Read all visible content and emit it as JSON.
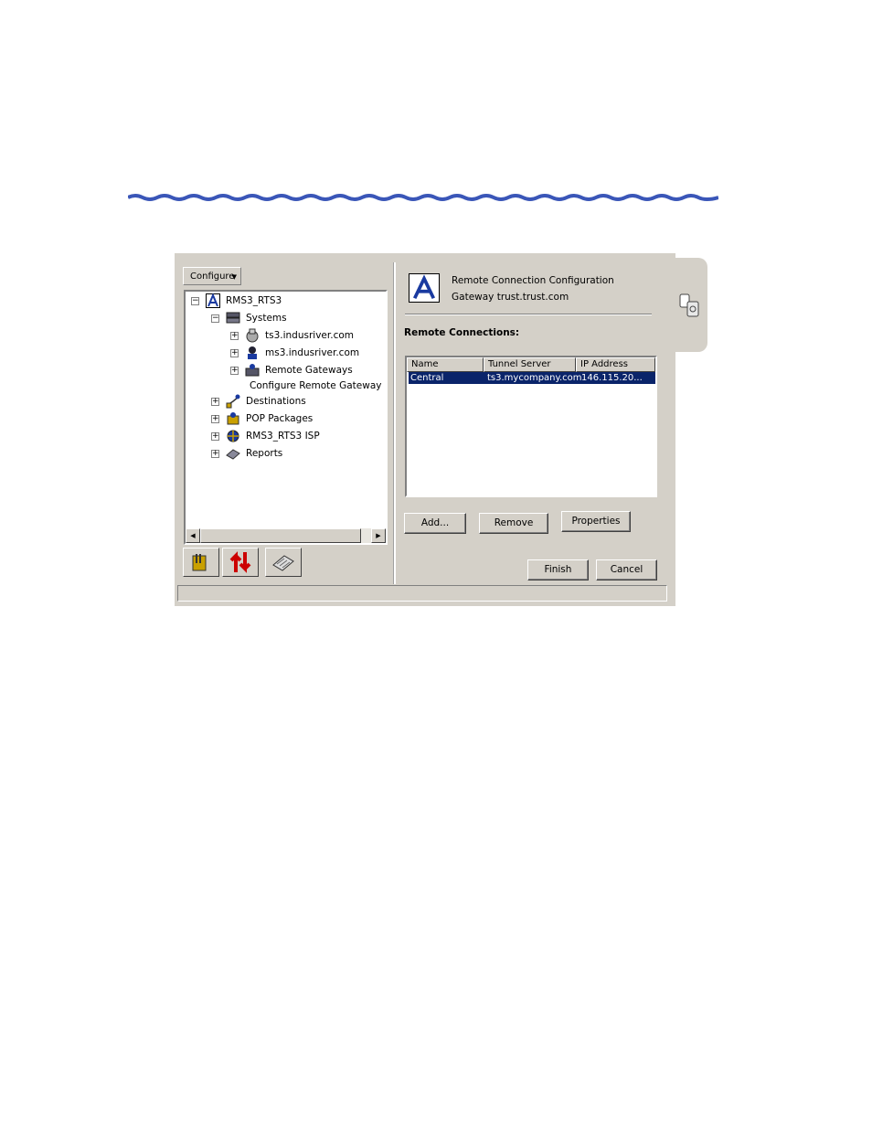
{
  "window": {
    "menu_button": "Configure",
    "colors": {
      "face": "#d4d0c8",
      "selection": "#0a246a",
      "wave": "#3a56b8"
    }
  },
  "tree": {
    "root": "RMS3_RTS3",
    "items": [
      {
        "label": "Systems",
        "icon": "systems-icon"
      },
      {
        "label": "ts3.indusriver.com",
        "icon": "server-icon"
      },
      {
        "label": "ms3.indusriver.com",
        "icon": "server-user-icon"
      },
      {
        "label": "Remote Gateways",
        "icon": "gateway-icon"
      },
      {
        "label": "Configure Remote Gateway",
        "icon": ""
      },
      {
        "label": "Destinations",
        "icon": "destinations-icon"
      },
      {
        "label": "POP Packages",
        "icon": "package-icon"
      },
      {
        "label": "RMS3_RTS3 ISP",
        "icon": "isp-icon"
      },
      {
        "label": "Reports",
        "icon": "reports-icon"
      }
    ]
  },
  "header": {
    "title_line1": "Remote Connection Configuration",
    "title_line2": "Gateway trust.trust.com"
  },
  "section_label": "Remote Connections:",
  "table": {
    "columns": [
      "Name",
      "Tunnel Server",
      "IP Address"
    ],
    "rows": [
      {
        "name": "Central",
        "tunnel_server": "ts3.mycompany.com",
        "ip_address": "146.115.20..."
      }
    ]
  },
  "buttons": {
    "add": "Add...",
    "remove": "Remove",
    "properties": "Properties",
    "finish": "Finish",
    "cancel": "Cancel"
  }
}
